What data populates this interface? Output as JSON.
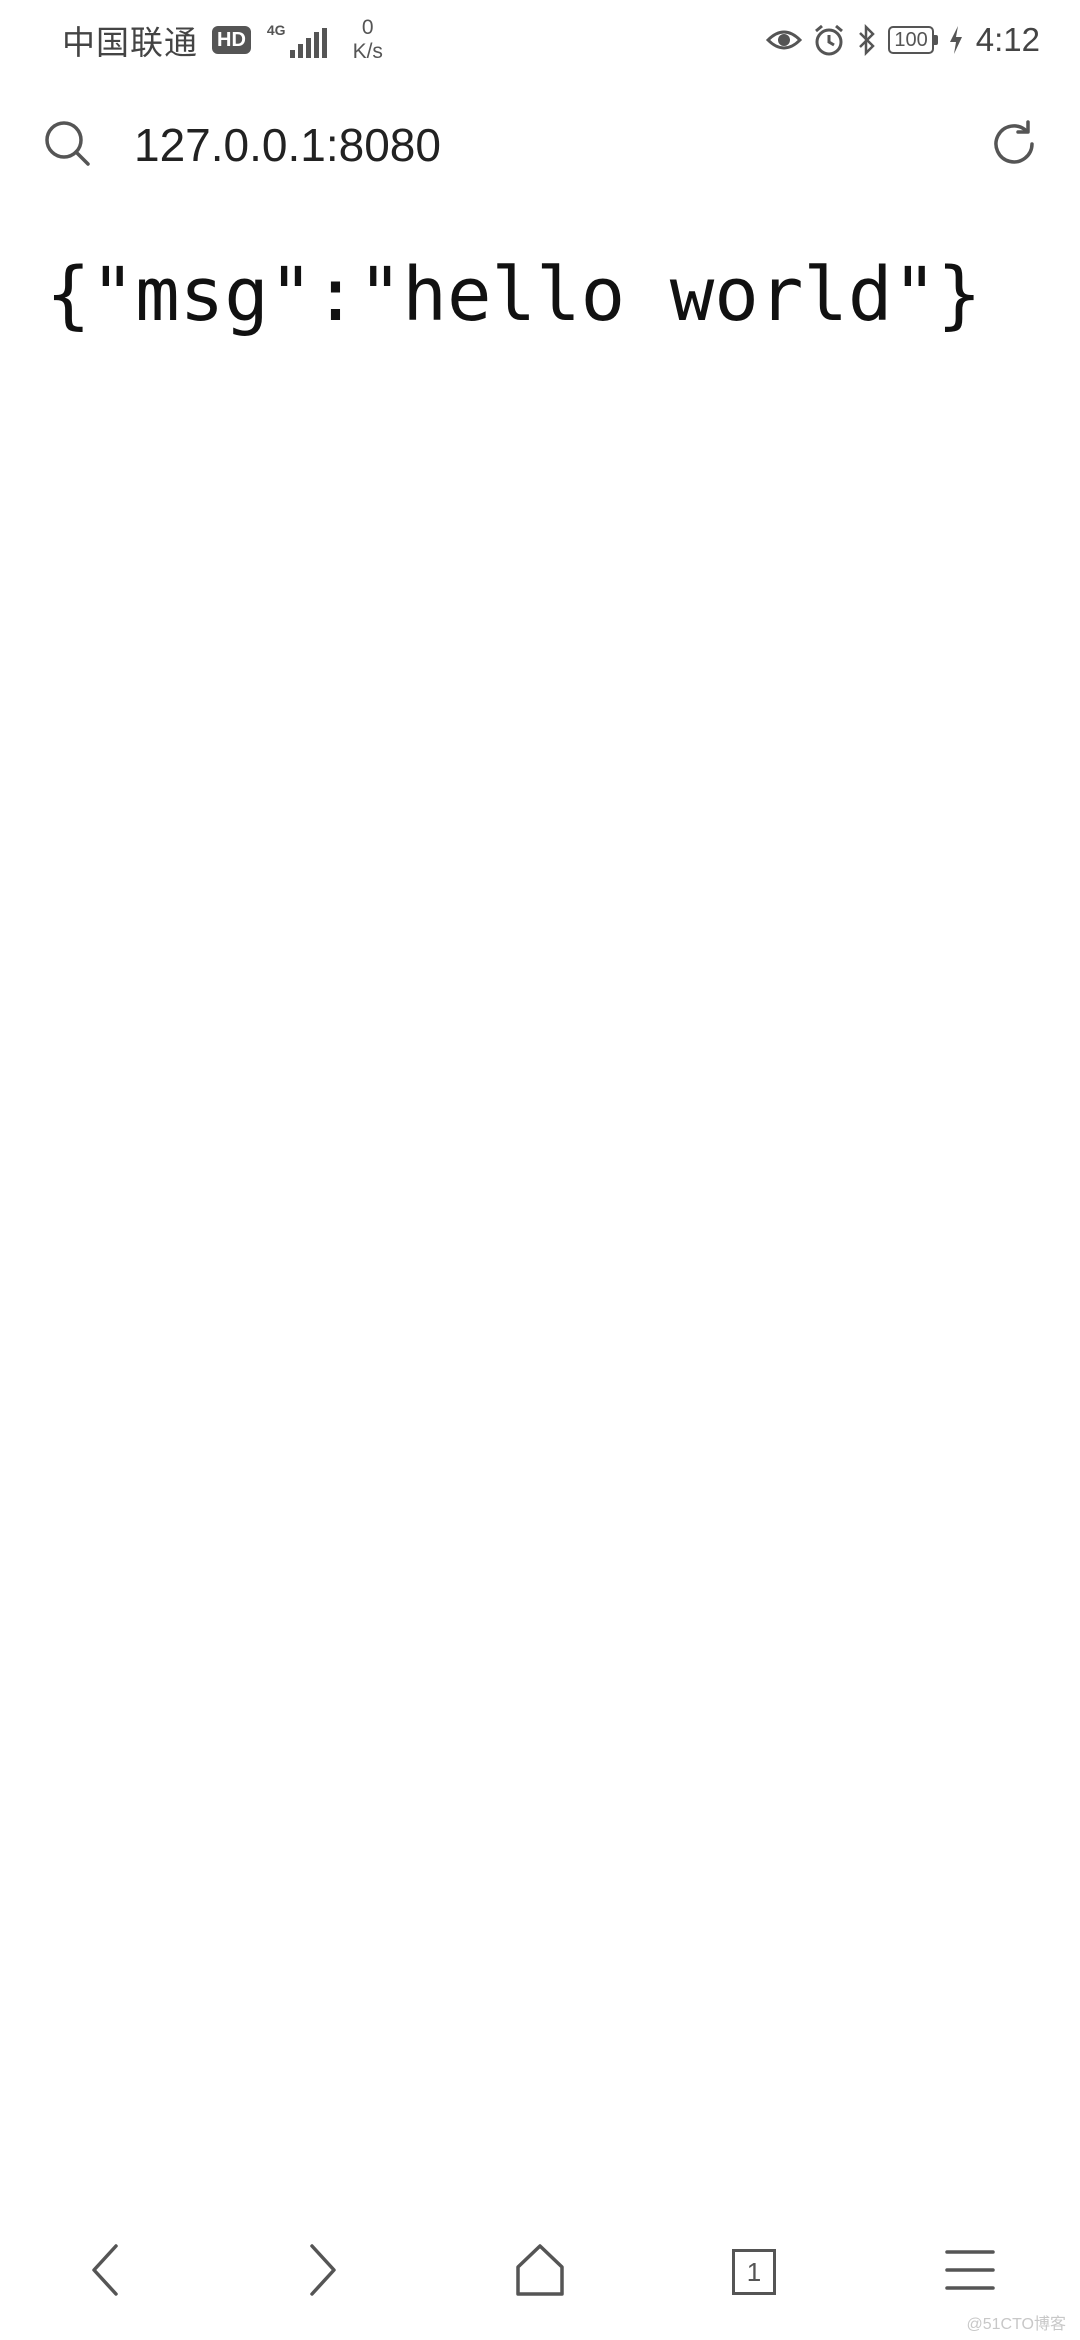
{
  "status_bar": {
    "carrier": "中国联通",
    "hd_badge": "HD",
    "network_type": "4G",
    "net_speed_value": "0",
    "net_speed_unit": "K/s",
    "battery_level": "100",
    "time": "4:12",
    "icons": [
      "eye-icon",
      "alarm-icon",
      "bluetooth-icon",
      "battery-icon",
      "charging-icon"
    ]
  },
  "address_bar": {
    "url": "127.0.0.1:8080",
    "icons": [
      "search-icon",
      "reload-icon"
    ]
  },
  "page": {
    "body_text": "{\"msg\":\"hello world\"}"
  },
  "toolbar": {
    "tab_count": "1",
    "icons": [
      "back-arrow-icon",
      "forward-arrow-icon",
      "home-icon",
      "tabs-icon",
      "menu-icon"
    ]
  },
  "watermark": "@51CTO博客",
  "colors": {
    "background": "#ffffff",
    "icon_gray": "#555555",
    "text": "#111111"
  }
}
